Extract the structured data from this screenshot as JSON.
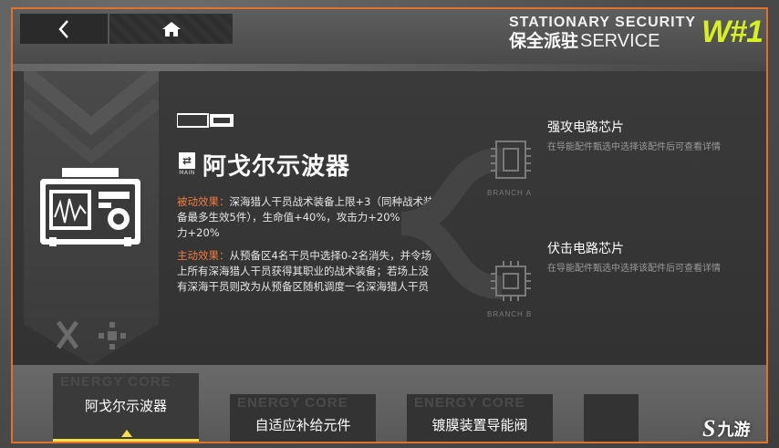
{
  "header": {
    "brand_line1": "STATIONARY SECURITY",
    "brand_cn": "保全派驻",
    "brand_line2": "SERVICE",
    "brand_logo": "W#1"
  },
  "item": {
    "title": "阿戈尔示波器",
    "badge_text": "MAIN",
    "passive_label": "被动效果：",
    "passive_text": "深海猎人干员战术装备上限+3（同种战术装备最多生效5件），生命值+40%，攻击力+20%，防御力+20%",
    "active_label": "主动效果：",
    "active_text": "从预备区4名干员中选择0-2名消失，并令场上所有深海猎人干员获得其职业的战术装备；若场上没有深海干员则改为从预备区随机调度一名深海猎人干员"
  },
  "branches": [
    {
      "tag": "BRANCH A",
      "name": "强攻电路芯片",
      "desc": "在导能配件甄选中选择该配件后可查看详情"
    },
    {
      "tag": "BRANCH B",
      "name": "伏击电路芯片",
      "desc": "在导能配件甄选中选择该配件后可查看详情"
    }
  ],
  "tabs": [
    {
      "label": "阿戈尔示波器",
      "active": true
    },
    {
      "label": "自适应补给元件",
      "active": false
    },
    {
      "label": "镀膜装置导能阀",
      "active": false
    }
  ],
  "tab_bg_word": "ENERGY CORE",
  "watermark": {
    "s": "S",
    "text": "九游"
  },
  "colors": {
    "accent_orange": "#e0722b",
    "label_orange": "#f07a3c",
    "logo_green": "#d8f020",
    "tab_yellow": "#f5e04a"
  },
  "icons": [
    "back-arrow-icon",
    "home-icon",
    "oscilloscope-icon",
    "chip-icon"
  ]
}
